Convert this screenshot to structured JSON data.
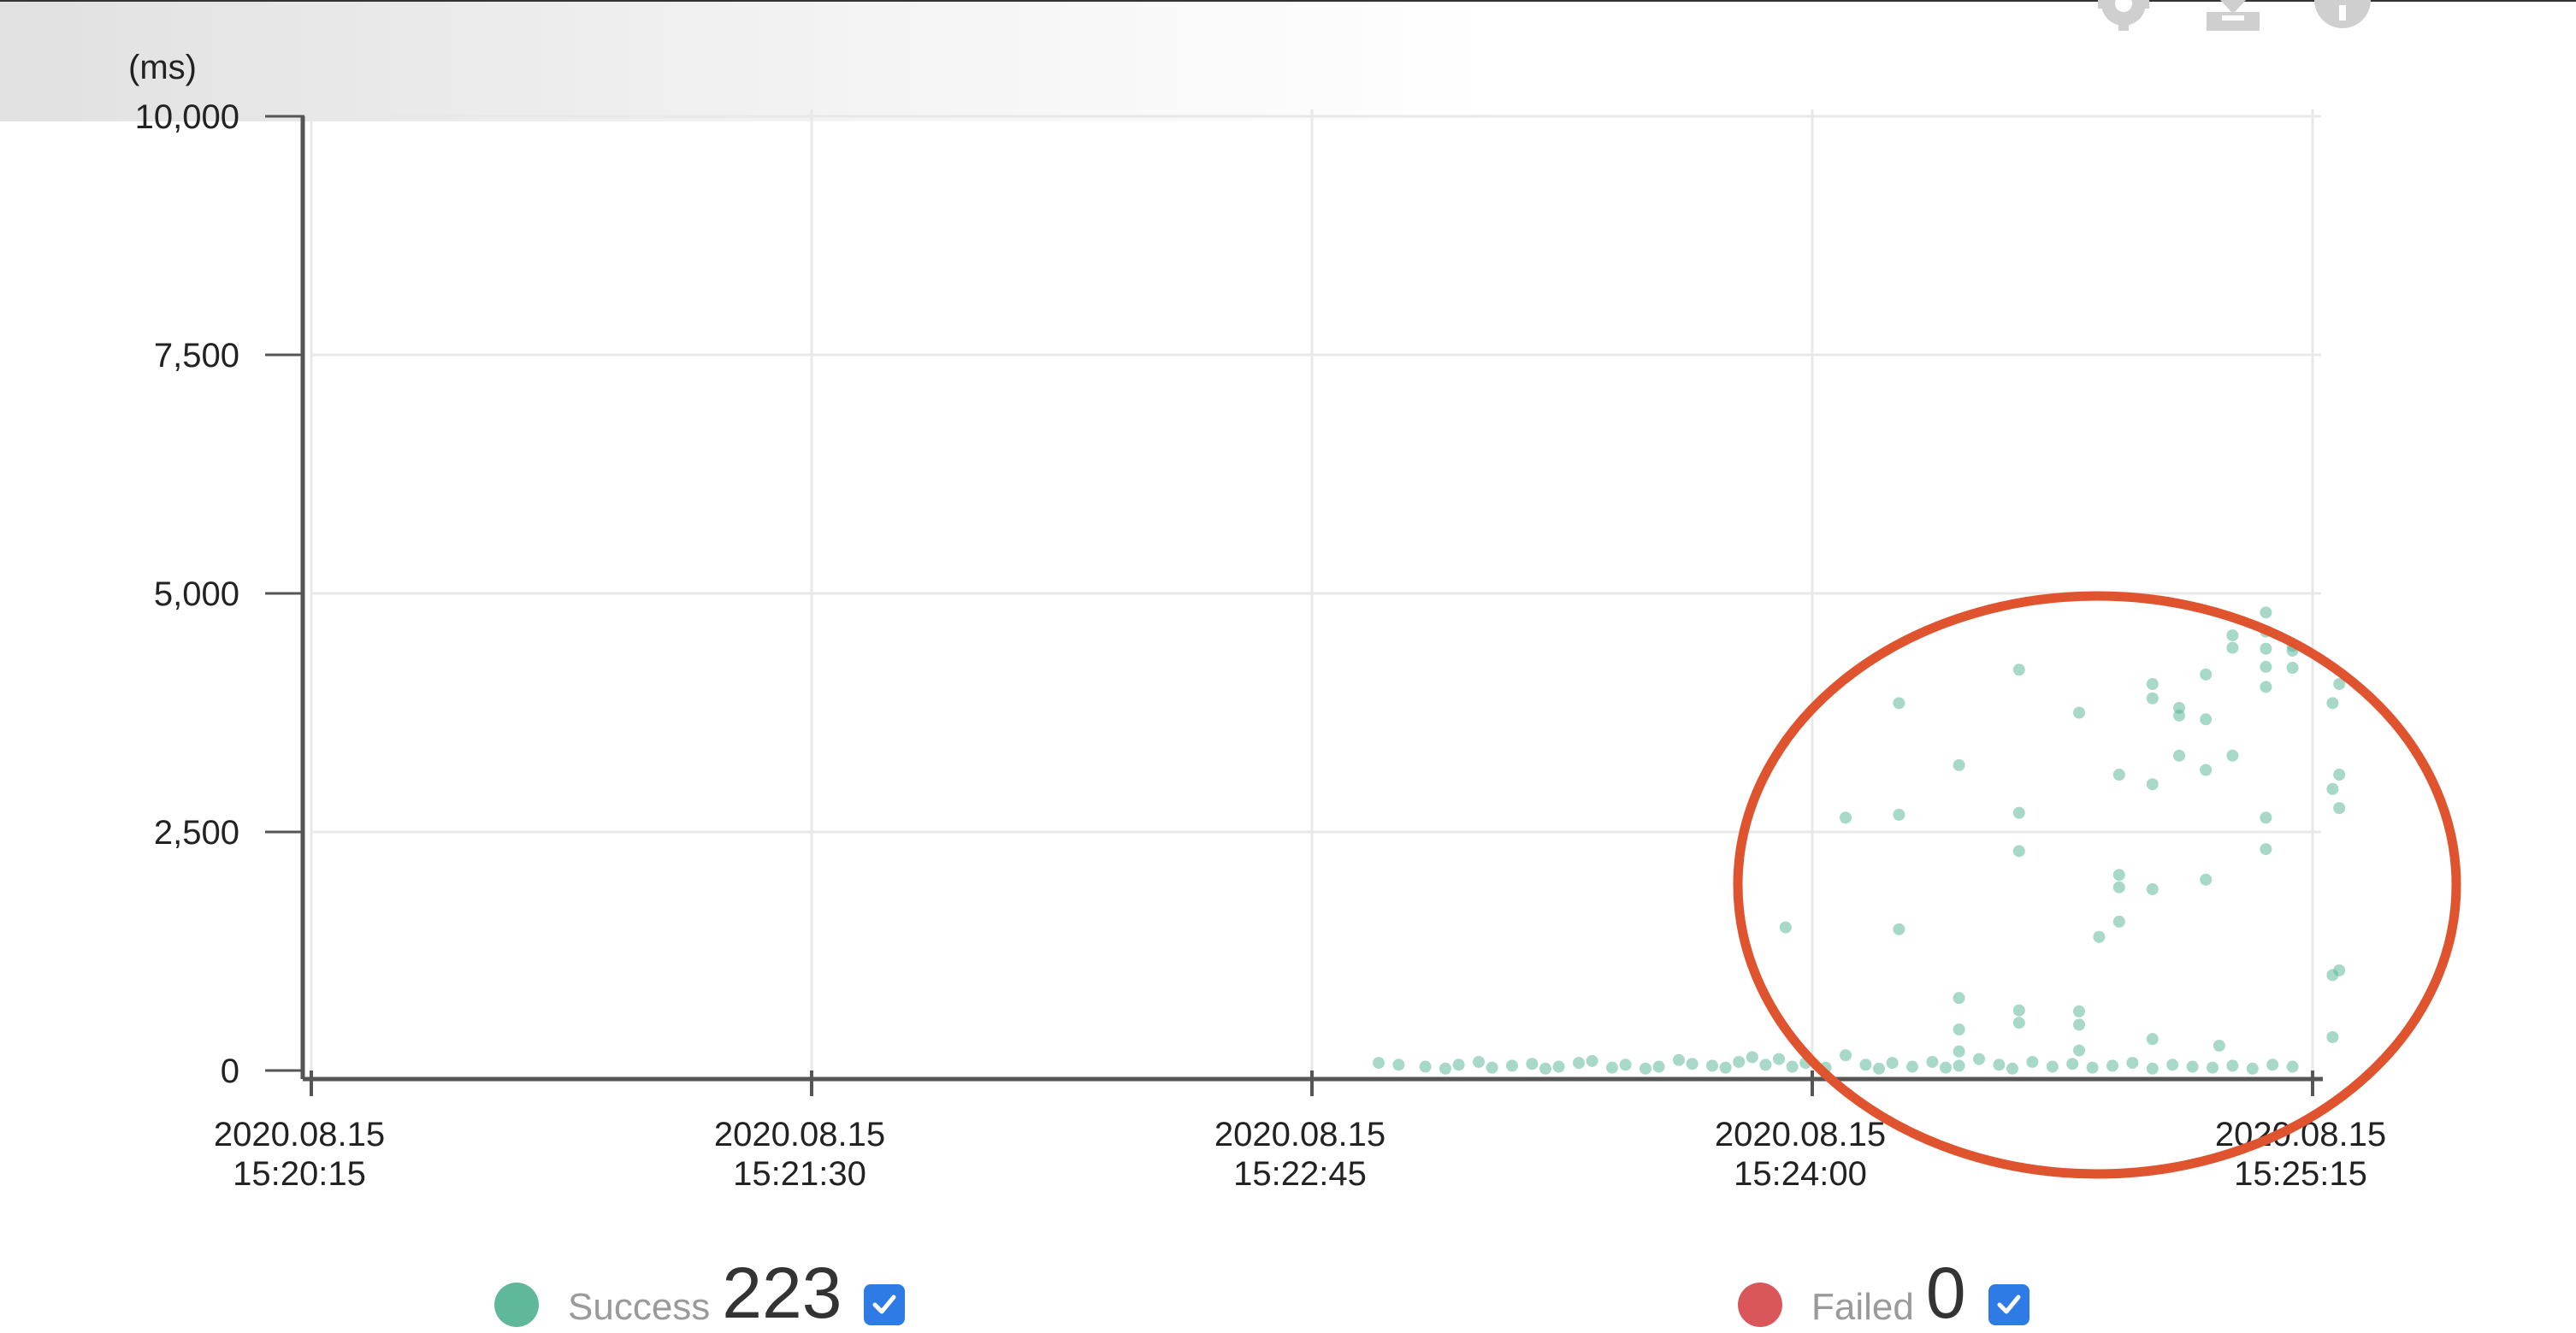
{
  "chart_data": {
    "type": "scatter",
    "ylabel": "(ms)",
    "ylim": [
      0,
      10000
    ],
    "y_ticks": [
      0,
      2500,
      5000,
      7500,
      10000
    ],
    "y_tick_labels": [
      "0",
      "2,500",
      "5,000",
      "7,500",
      "10,000"
    ],
    "x_range": [
      "2020-08-15 15:20:15",
      "2020-08-15 15:25:15"
    ],
    "x_ticks": [
      "2020-08-15 15:20:15",
      "2020-08-15 15:21:30",
      "2020-08-15 15:22:45",
      "2020-08-15 15:24:00",
      "2020-08-15 15:25:15"
    ],
    "x_tick_labels": [
      [
        "2020.08.15",
        "15:20:15"
      ],
      [
        "2020.08.15",
        "15:21:30"
      ],
      [
        "2020.08.15",
        "15:22:45"
      ],
      [
        "2020.08.15",
        "15:24:00"
      ],
      [
        "2020.08.15",
        "15:25:15"
      ]
    ],
    "grid": true,
    "series": [
      {
        "name": "Success",
        "color": "#5fb89a",
        "points": [
          [
            "15:22:55",
            80
          ],
          [
            "15:22:58",
            60
          ],
          [
            "15:23:02",
            40
          ],
          [
            "15:23:05",
            20
          ],
          [
            "15:23:07",
            60
          ],
          [
            "15:23:10",
            90
          ],
          [
            "15:23:12",
            30
          ],
          [
            "15:23:15",
            50
          ],
          [
            "15:23:18",
            70
          ],
          [
            "15:23:20",
            20
          ],
          [
            "15:23:22",
            40
          ],
          [
            "15:23:25",
            80
          ],
          [
            "15:23:27",
            100
          ],
          [
            "15:23:30",
            30
          ],
          [
            "15:23:32",
            60
          ],
          [
            "15:23:35",
            20
          ],
          [
            "15:23:37",
            40
          ],
          [
            "15:23:40",
            110
          ],
          [
            "15:23:42",
            70
          ],
          [
            "15:23:45",
            50
          ],
          [
            "15:23:47",
            30
          ],
          [
            "15:23:49",
            90
          ],
          [
            "15:23:51",
            140
          ],
          [
            "15:23:53",
            60
          ],
          [
            "15:23:55",
            120
          ],
          [
            "15:23:57",
            40
          ],
          [
            "15:23:59",
            80
          ],
          [
            "15:24:02",
            30
          ],
          [
            "15:24:05",
            160
          ],
          [
            "15:24:08",
            60
          ],
          [
            "15:24:10",
            20
          ],
          [
            "15:24:12",
            80
          ],
          [
            "15:24:15",
            40
          ],
          [
            "15:24:18",
            90
          ],
          [
            "15:24:20",
            30
          ],
          [
            "15:24:22",
            50
          ],
          [
            "15:24:25",
            120
          ],
          [
            "15:24:28",
            60
          ],
          [
            "15:24:30",
            20
          ],
          [
            "15:24:33",
            90
          ],
          [
            "15:24:36",
            40
          ],
          [
            "15:24:39",
            70
          ],
          [
            "15:24:42",
            30
          ],
          [
            "15:24:45",
            50
          ],
          [
            "15:24:48",
            80
          ],
          [
            "15:24:51",
            20
          ],
          [
            "15:24:54",
            60
          ],
          [
            "15:24:57",
            40
          ],
          [
            "15:25:00",
            30
          ],
          [
            "15:25:03",
            50
          ],
          [
            "15:25:06",
            20
          ],
          [
            "15:25:09",
            60
          ],
          [
            "15:25:12",
            40
          ],
          [
            "15:23:56",
            1500
          ],
          [
            "15:24:05",
            2650
          ],
          [
            "15:24:13",
            3850
          ],
          [
            "15:24:13",
            2680
          ],
          [
            "15:24:13",
            1480
          ],
          [
            "15:24:22",
            3200
          ],
          [
            "15:24:22",
            760
          ],
          [
            "15:24:22",
            430
          ],
          [
            "15:24:22",
            200
          ],
          [
            "15:24:31",
            4200
          ],
          [
            "15:24:31",
            2700
          ],
          [
            "15:24:31",
            2300
          ],
          [
            "15:24:31",
            630
          ],
          [
            "15:24:31",
            500
          ],
          [
            "15:24:40",
            3750
          ],
          [
            "15:24:40",
            620
          ],
          [
            "15:24:40",
            480
          ],
          [
            "15:24:40",
            210
          ],
          [
            "15:24:43",
            1400
          ],
          [
            "15:24:46",
            3100
          ],
          [
            "15:24:46",
            2050
          ],
          [
            "15:24:46",
            1920
          ],
          [
            "15:24:46",
            1560
          ],
          [
            "15:24:51",
            3000
          ],
          [
            "15:24:51",
            1900
          ],
          [
            "15:24:51",
            330
          ],
          [
            "15:24:51",
            4050
          ],
          [
            "15:24:51",
            3900
          ],
          [
            "15:24:55",
            3800
          ],
          [
            "15:24:55",
            3720
          ],
          [
            "15:24:55",
            3300
          ],
          [
            "15:24:59",
            4150
          ],
          [
            "15:24:59",
            3680
          ],
          [
            "15:24:59",
            3150
          ],
          [
            "15:24:59",
            2000
          ],
          [
            "15:25:01",
            260
          ],
          [
            "15:25:03",
            3300
          ],
          [
            "15:25:03",
            4560
          ],
          [
            "15:25:03",
            4430
          ],
          [
            "15:25:08",
            4800
          ],
          [
            "15:25:08",
            4600
          ],
          [
            "15:25:08",
            4420
          ],
          [
            "15:25:08",
            4230
          ],
          [
            "15:25:08",
            4020
          ],
          [
            "15:25:08",
            2650
          ],
          [
            "15:25:08",
            2320
          ],
          [
            "15:25:12",
            4450
          ],
          [
            "15:25:12",
            4400
          ],
          [
            "15:25:12",
            4220
          ],
          [
            "15:25:19",
            4050
          ],
          [
            "15:25:18",
            3850
          ],
          [
            "15:25:19",
            3100
          ],
          [
            "15:25:19",
            2750
          ],
          [
            "15:25:18",
            2950
          ],
          [
            "15:25:18",
            1000
          ],
          [
            "15:25:19",
            1050
          ],
          [
            "15:25:23",
            2250
          ],
          [
            "15:25:21",
            550
          ],
          [
            "15:25:23",
            550
          ],
          [
            "15:25:23",
            380
          ],
          [
            "15:25:18",
            350
          ]
        ]
      },
      {
        "name": "Failed",
        "color": "#d9575a",
        "points": []
      }
    ],
    "annotation": {
      "type": "ellipse",
      "color": "#e0532f"
    }
  },
  "legend": {
    "success": {
      "label": "Success",
      "count": "223",
      "color": "#5fb89a",
      "checked": true
    },
    "failed": {
      "label": "Failed",
      "count": "0",
      "color": "#d9575a",
      "checked": true
    }
  },
  "toolbar": {
    "icons": [
      "gear-icon",
      "download-icon",
      "info-icon"
    ]
  }
}
